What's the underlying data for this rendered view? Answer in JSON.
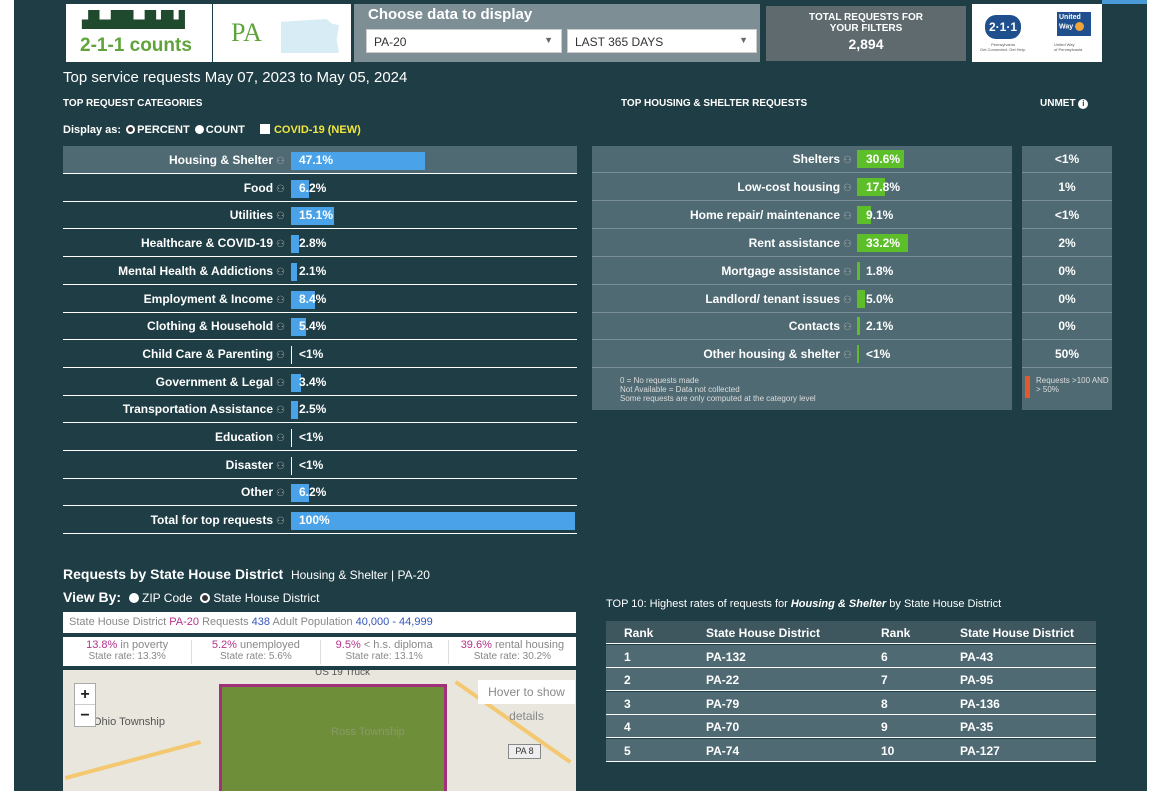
{
  "header": {
    "logo_text": "2-1-1 counts",
    "state": "PA",
    "choose_label": "Choose data to display",
    "district_select": "PA-20",
    "period_select": "LAST 365 DAYS",
    "total_label": "TOTAL REQUESTS FOR YOUR FILTERS",
    "total_value": "2,894",
    "badge_211": "2·1·1",
    "united_way": "United Way"
  },
  "page_title": "Top service requests May 07, 2023 to May 05, 2024",
  "categories_label": "TOP REQUEST CATEGORIES",
  "housing_label": "TOP HOUSING & SHELTER REQUESTS",
  "unmet_label": "UNMET",
  "display_as": {
    "label": "Display as:",
    "percent": "PERCENT",
    "count": "COUNT",
    "covid": "COVID-19 (NEW)"
  },
  "categories": [
    {
      "name": "Housing & Shelter",
      "value": "47.1%",
      "pct": 47.1
    },
    {
      "name": "Food",
      "value": "6.2%",
      "pct": 6.2
    },
    {
      "name": "Utilities",
      "value": "15.1%",
      "pct": 15.1
    },
    {
      "name": "Healthcare & COVID-19",
      "value": "2.8%",
      "pct": 2.8
    },
    {
      "name": "Mental Health & Addictions",
      "value": "2.1%",
      "pct": 2.1
    },
    {
      "name": "Employment & Income",
      "value": "8.4%",
      "pct": 8.4
    },
    {
      "name": "Clothing & Household",
      "value": "5.4%",
      "pct": 5.4
    },
    {
      "name": "Child Care & Parenting",
      "value": "<1%",
      "pct": 0
    },
    {
      "name": "Government & Legal",
      "value": "3.4%",
      "pct": 3.4
    },
    {
      "name": "Transportation Assistance",
      "value": "2.5%",
      "pct": 2.5
    },
    {
      "name": "Education",
      "value": "<1%",
      "pct": 0
    },
    {
      "name": "Disaster",
      "value": "<1%",
      "pct": 0
    },
    {
      "name": "Other",
      "value": "6.2%",
      "pct": 6.2
    },
    {
      "name": "Total for top requests",
      "value": "100%",
      "pct": 100
    }
  ],
  "housing": [
    {
      "name": "Shelters",
      "value": "30.6%",
      "pct": 30.6,
      "unmet": "<1%"
    },
    {
      "name": "Low-cost housing",
      "value": "17.8%",
      "pct": 17.8,
      "unmet": "1%"
    },
    {
      "name": "Home repair/ maintenance",
      "value": "9.1%",
      "pct": 9.1,
      "unmet": "<1%"
    },
    {
      "name": "Rent assistance",
      "value": "33.2%",
      "pct": 33.2,
      "unmet": "2%"
    },
    {
      "name": "Mortgage assistance",
      "value": "1.8%",
      "pct": 1.8,
      "unmet": "0%"
    },
    {
      "name": "Landlord/ tenant issues",
      "value": "5.0%",
      "pct": 5.0,
      "unmet": "0%"
    },
    {
      "name": "Contacts",
      "value": "2.1%",
      "pct": 2.1,
      "unmet": "0%"
    },
    {
      "name": "Other housing & shelter",
      "value": "<1%",
      "pct": 0,
      "unmet": "50%"
    }
  ],
  "housing_note": [
    "0 = No requests made",
    "Not Available = Data not collected",
    "Some requests are only computed at the category level"
  ],
  "unmet_legend": "Requests >100 AND > 50%",
  "map_section": {
    "title": "Requests by State House District",
    "subtitle": "Housing & Shelter | PA-20",
    "view_by": "View By:",
    "opt_zip": "ZIP Code",
    "opt_district": "State House District",
    "info": {
      "district_label": "State House District",
      "district": "PA-20",
      "requests_label": "Requests",
      "requests": "438",
      "pop_label": "Adult Population",
      "pop": "40,000 - 44,999"
    },
    "stats": [
      {
        "big": "13.8%",
        "label": "in poverty",
        "state": "State rate: 13.3%"
      },
      {
        "big": "5.2%",
        "label": "unemployed",
        "state": "State rate: 5.6%"
      },
      {
        "big": "9.5%",
        "label": "< h.s. diploma",
        "state": "State rate: 13.1%"
      },
      {
        "big": "39.6%",
        "label": "rental housing",
        "state": "State rate: 30.2%"
      }
    ],
    "hover": "Hover to show details",
    "map_labels": [
      "Ohio Township",
      "Ross Township",
      "PA 8",
      "US 19 Truck"
    ]
  },
  "top10": {
    "title_pre": "TOP 10: Highest rates of requests for",
    "title_cat": "Housing & Shelter",
    "title_post": "by State House District",
    "headers": [
      "Rank",
      "State House District",
      "Rank",
      "State House District"
    ],
    "rows": [
      [
        "1",
        "PA-132",
        "6",
        "PA-43"
      ],
      [
        "2",
        "PA-22",
        "7",
        "PA-95"
      ],
      [
        "3",
        "PA-79",
        "8",
        "PA-136"
      ],
      [
        "4",
        "PA-70",
        "9",
        "PA-35"
      ],
      [
        "5",
        "PA-74",
        "10",
        "PA-127"
      ]
    ]
  }
}
